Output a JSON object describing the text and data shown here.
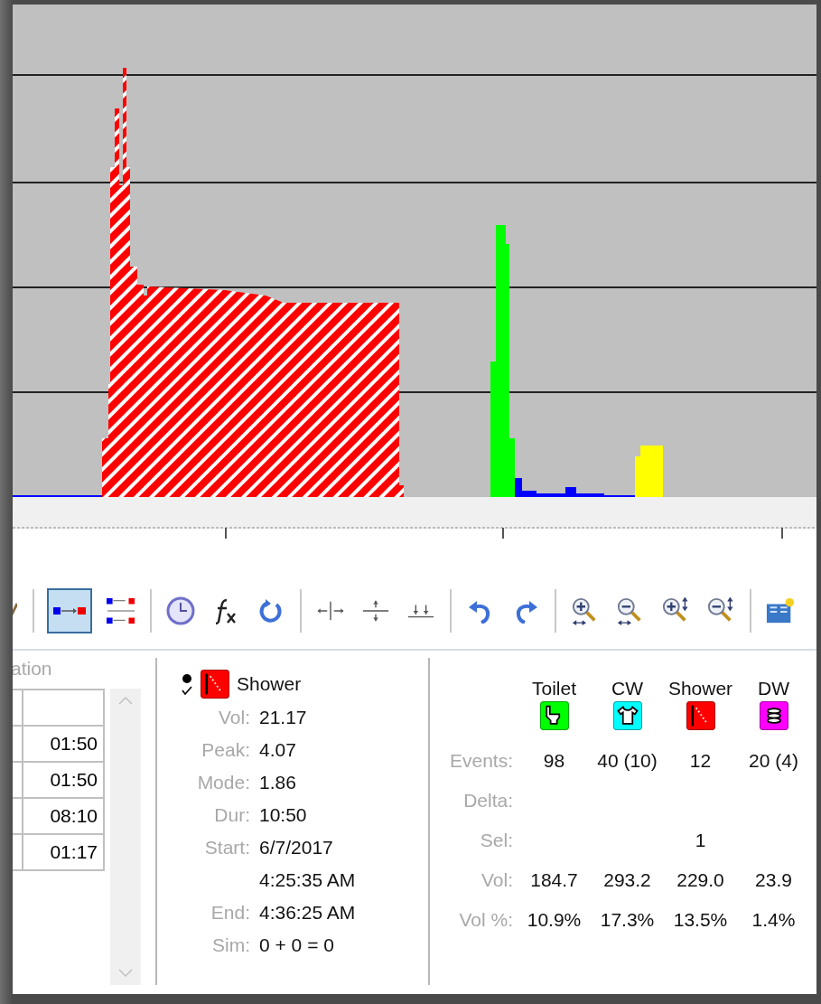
{
  "toolbar": {
    "groups": [
      [
        {
          "kind": "pencil",
          "selected": false
        }
      ],
      [
        {
          "kind": "single-flow",
          "selected": true
        },
        {
          "kind": "multi-flow",
          "selected": false
        }
      ],
      [
        {
          "kind": "clock",
          "selected": false
        },
        {
          "kind": "function",
          "selected": false
        },
        {
          "kind": "refresh",
          "selected": false
        }
      ],
      [
        {
          "kind": "split",
          "selected": false
        },
        {
          "kind": "split-vertical",
          "selected": false
        },
        {
          "kind": "merge",
          "selected": false
        }
      ],
      [
        {
          "kind": "undo",
          "selected": false
        },
        {
          "kind": "redo",
          "selected": false
        }
      ],
      [
        {
          "kind": "zoom-in",
          "selected": false
        },
        {
          "kind": "zoom-out",
          "selected": false
        },
        {
          "kind": "zoom-in-vertical",
          "selected": false
        },
        {
          "kind": "zoom-out-vertical",
          "selected": false
        }
      ],
      [
        {
          "kind": "book",
          "selected": false
        }
      ]
    ]
  },
  "events_table": {
    "header": "ation",
    "rows": [
      {
        "duration": "01:50"
      },
      {
        "duration": "01:50"
      },
      {
        "duration": "08:10"
      },
      {
        "duration": "01:17"
      }
    ]
  },
  "selected_event": {
    "name": "Shower",
    "kind": "shower",
    "color": "#ff0000",
    "fields": [
      {
        "label": "Vol:",
        "value": "21.17"
      },
      {
        "label": "Peak:",
        "value": "4.07"
      },
      {
        "label": "Mode:",
        "value": "1.86"
      },
      {
        "label": "Dur:",
        "value": "10:50"
      },
      {
        "label": "Start:",
        "value": "6/7/2017"
      },
      {
        "value": "4:25:35 AM"
      },
      {
        "label": "End:",
        "value": "4:36:25 AM"
      },
      {
        "label": "Sim:",
        "value": "0 + 0 = 0"
      }
    ]
  },
  "summary": {
    "columns": [
      {
        "name": "Toilet",
        "kind": "toilet",
        "color": "#00ff00"
      },
      {
        "name": "CW",
        "kind": "shirt",
        "color": "#00ffff"
      },
      {
        "name": "Shower",
        "kind": "shower",
        "color": "#ff0000"
      },
      {
        "name": "DW",
        "kind": "dishes",
        "color": "#ff00ff"
      }
    ],
    "rows": [
      {
        "label": "Events:",
        "values": {
          "toilet": "98",
          "shirt": "40 (10)",
          "shower": "12",
          "dishes": "20 (4)"
        }
      },
      {
        "label": "Delta:"
      },
      {
        "label": "Sel:",
        "values": {
          "shower": "1"
        }
      },
      {
        "label": "Vol:",
        "values": {
          "toilet": "184.7",
          "shirt": "293.2",
          "shower": "229.0",
          "dishes": "23.9"
        }
      },
      {
        "label": "Vol %:",
        "values": {
          "toilet": "10.9%",
          "shirt": "17.3%",
          "shower": "13.5%",
          "dishes": "1.4%"
        }
      }
    ]
  }
}
